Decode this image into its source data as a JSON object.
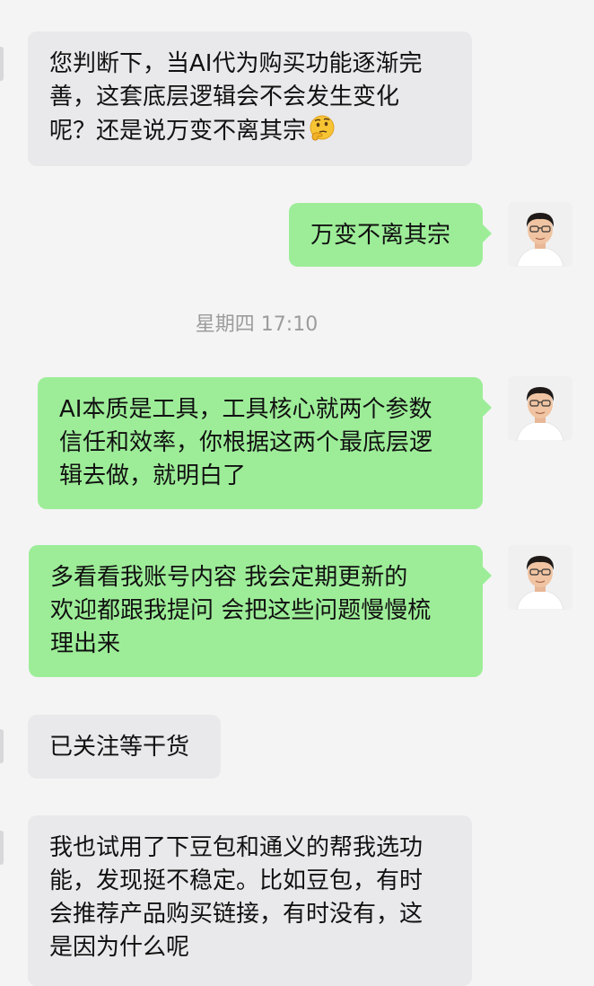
{
  "messages": [
    {
      "side": "incoming",
      "lines": [
        "您判断下，当AI代为购买功能逐渐完",
        "善，这套底层逻辑会不会发生变化",
        "呢？还是说万变不离其宗"
      ],
      "emoji": "thinking-face"
    },
    {
      "side": "outgoing",
      "lines": [
        "万变不离其宗"
      ]
    },
    {
      "side": "outgoing",
      "lines": [
        "AI本质是工具，工具核心就两个参数",
        "信任和效率，你根据这两个最底层逻",
        "辑去做，就明白了"
      ]
    },
    {
      "side": "outgoing",
      "lines": [
        "多看看我账号内容 我会定期更新的",
        "欢迎都跟我提问 会把这些问题慢慢梳",
        "理出来"
      ]
    },
    {
      "side": "incoming",
      "lines": [
        "已关注等干货"
      ]
    },
    {
      "side": "incoming",
      "lines": [
        "我也试用了下豆包和通义的帮我选功",
        "能，发现挺不稳定。比如豆包，有时",
        "会推荐产品购买链接，有时没有，这",
        "是因为什么呢"
      ]
    }
  ],
  "timestamp": "星期四 17:10",
  "colors": {
    "background": "#f4f4f4",
    "incoming_bubble": "#e9e9eb",
    "outgoing_bubble": "#9ded98",
    "timestamp_text": "#9c9c9c"
  }
}
